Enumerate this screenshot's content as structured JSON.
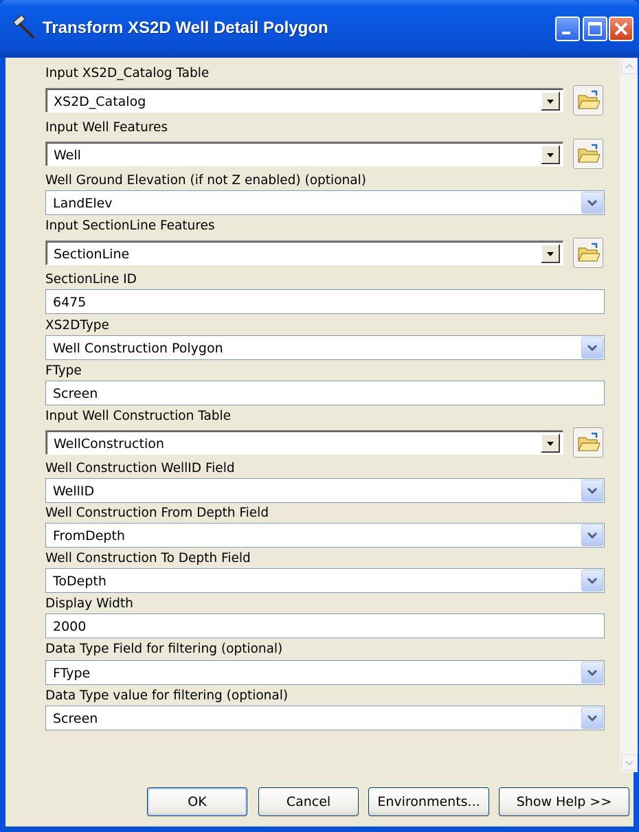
{
  "window": {
    "title": "Transform XS2D Well Detail Polygon"
  },
  "form": {
    "fields": [
      {
        "label": "Input XS2D_Catalog Table",
        "value": "XS2D_Catalog"
      },
      {
        "label": "Input Well Features",
        "value": "Well"
      },
      {
        "label": "Well Ground Elevation (if not Z enabled) (optional)",
        "value": "LandElev"
      },
      {
        "label": "Input SectionLine Features",
        "value": "SectionLine"
      },
      {
        "label": "SectionLine ID",
        "value": "6475"
      },
      {
        "label": "XS2DType",
        "value": "Well Construction Polygon"
      },
      {
        "label": "FType",
        "value": "Screen"
      },
      {
        "label": "Input Well Construction Table",
        "value": "WellConstruction"
      },
      {
        "label": "Well Construction WellID Field",
        "value": "WellID"
      },
      {
        "label": "Well Construction From Depth Field",
        "value": "FromDepth"
      },
      {
        "label": "Well Construction To Depth Field",
        "value": "ToDepth"
      },
      {
        "label": "Display Width",
        "value": "2000"
      },
      {
        "label": "Data Type Field for filtering (optional)",
        "value": "FType"
      },
      {
        "label": "Data Type value for filtering (optional)",
        "value": "Screen"
      }
    ]
  },
  "buttons": {
    "ok": "OK",
    "cancel": "Cancel",
    "environments": "Environments...",
    "show_help": "Show Help >>"
  },
  "colors": {
    "titlebar": "#0A54DC",
    "dialog_bg": "#ECE9D8",
    "field_border": "#7F9DB9"
  }
}
